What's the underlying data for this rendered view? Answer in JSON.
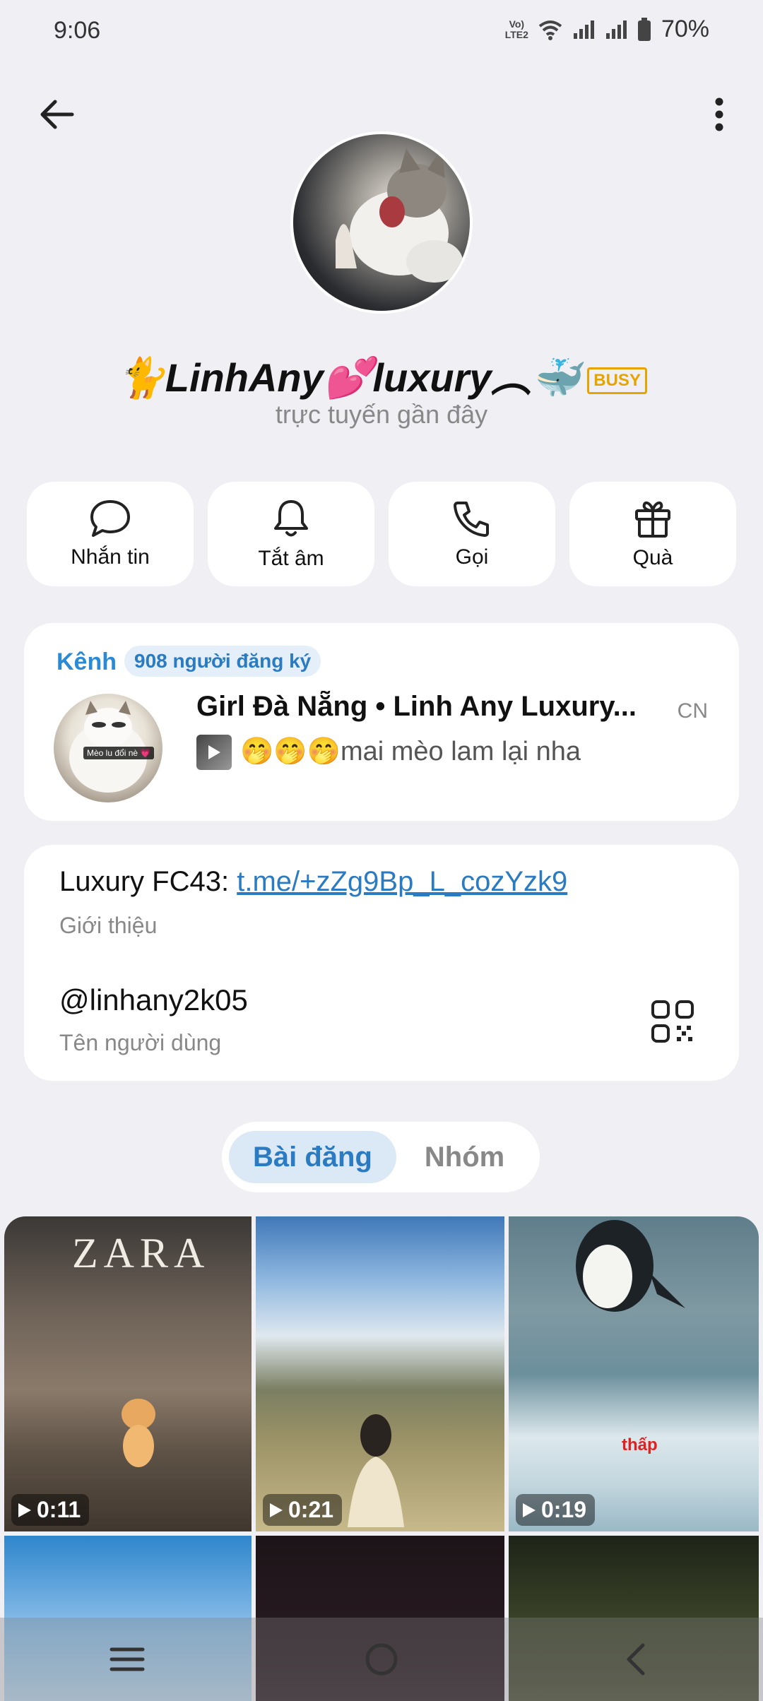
{
  "status_bar": {
    "time": "9:06",
    "lte_label": "Vo) LTE2",
    "battery": "70%"
  },
  "profile": {
    "name": "🐈LinhAny💕luxury︵🐳",
    "badge": "BUSY",
    "status": "trực tuyến gần đây"
  },
  "actions": [
    {
      "label": "Nhắn tin",
      "icon": "message-icon"
    },
    {
      "label": "Tắt âm",
      "icon": "bell-icon"
    },
    {
      "label": "Gọi",
      "icon": "phone-icon"
    },
    {
      "label": "Quà",
      "icon": "gift-icon"
    }
  ],
  "channel": {
    "title": "Kênh",
    "subscribers": "908 người đăng ký",
    "avatar_caption": "Mèo lu đổi nè 💗",
    "name": "Girl Đà Nẵng • Linh Any Luxury...",
    "day": "CN",
    "message": "🤭🤭🤭mai mèo lam lại nha"
  },
  "info": {
    "bio_prefix": "Luxury FC43: ",
    "bio_link": "t.me/+zZg9Bp_L_cozYzk9",
    "bio_caption": "Giới thiệu",
    "username": "@linhany2k05",
    "username_caption": "Tên người dùng"
  },
  "tabs": {
    "posts": "Bài đăng",
    "groups": "Nhóm"
  },
  "media": [
    {
      "duration": "0:11",
      "overlay_text": "ZARA"
    },
    {
      "duration": "0:21"
    },
    {
      "duration": "0:19",
      "overlay_text": "thấp"
    }
  ],
  "colors": {
    "accent": "#2b7bc2",
    "badge": "#e6a400",
    "background": "#efeff4"
  }
}
